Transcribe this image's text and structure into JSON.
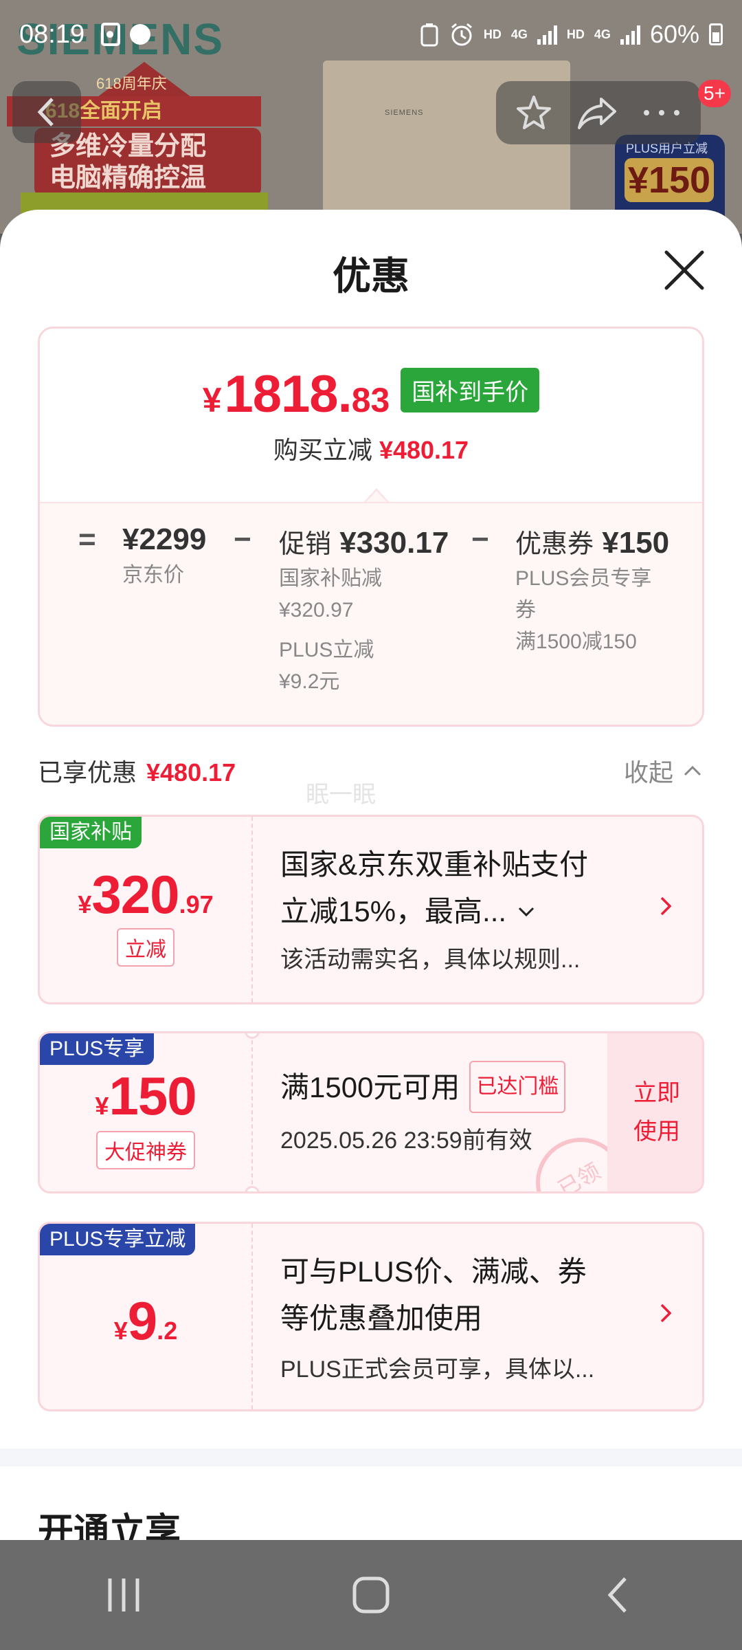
{
  "status_bar": {
    "time": "08:19",
    "hd1": "HD",
    "net1": "4G",
    "hd2": "HD",
    "net2": "4G",
    "battery": "60%"
  },
  "background": {
    "brand": "SIEMENS",
    "anniversary": "618周年庆",
    "promo_banner": "618全面开启",
    "slogan_line1": "多维冷量分配",
    "slogan_line2": "电脑精确控温",
    "plus_badge_title": "PLUS用户立减",
    "plus_badge_value": "¥150",
    "cart_badge": "5+"
  },
  "sheet": {
    "title": "优惠",
    "summary": {
      "final_currency": "¥",
      "final_int": "1818.",
      "final_dec": "83",
      "final_tag": "国补到手价",
      "saving_label": "购买立减",
      "saving_amount": "¥480.17",
      "eq": "=",
      "minus": "−",
      "jd_price": "¥2299",
      "jd_label": "京东价",
      "promo_label": "促销",
      "promo_amount": "¥330.17",
      "promo_sub1_label": "国家补贴减",
      "promo_sub1_value": "¥320.97",
      "promo_sub2_label": "PLUS立减",
      "promo_sub2_value": "¥9.2元",
      "coupon_label": "优惠券",
      "coupon_amount": "¥150",
      "coupon_sub1a": "PLUS会员专享",
      "coupon_sub1b": "券",
      "coupon_sub2": "满1500减150"
    },
    "enjoyed_label": "已享优惠",
    "enjoyed_amount": "¥480.17",
    "collapse_label": "收起",
    "watermark": "眠一眠",
    "coupons": [
      {
        "tag": "国家补贴",
        "currency": "¥",
        "int": "320",
        "dec": ".97",
        "pill": "立减",
        "line1": "国家&京东双重补贴支付",
        "line2": "立减15%，最高...",
        "note": "该活动需实名，具体以规则..."
      },
      {
        "tag": "PLUS专享",
        "currency": "¥",
        "int": "150",
        "dec": "",
        "pill": "大促神券",
        "line1": "满1500元可用",
        "reached": "已达门槛",
        "note": "2025.05.26 23:59前有效",
        "use_line1": "立即",
        "use_line2": "使用",
        "stamp": "已领"
      },
      {
        "tag": "PLUS专享立减",
        "currency": "¥",
        "int": "9",
        "dec": ".2",
        "line1": "可与PLUS价、满减、券",
        "line2": "等优惠叠加使用",
        "note": "PLUS正式会员可享，具体以..."
      }
    ],
    "next_section_title": "开通立享"
  },
  "colors": {
    "accent_red": "#ee1d36",
    "green_tag": "#2aa63b",
    "plus_blue": "#2a46a8"
  }
}
